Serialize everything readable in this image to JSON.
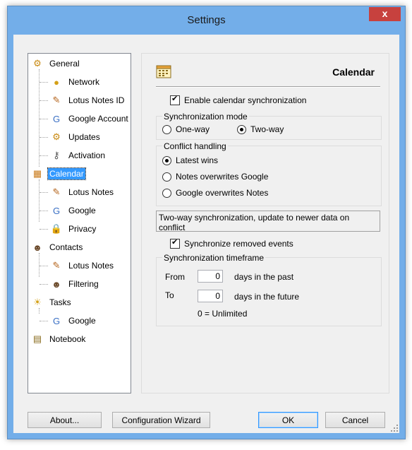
{
  "window": {
    "title": "Settings",
    "close_glyph": "x"
  },
  "tree": [
    {
      "label": "General",
      "icon": "gears-icon",
      "level": 0
    },
    {
      "label": "Network",
      "icon": "network-icon",
      "level": 1
    },
    {
      "label": "Lotus Notes ID",
      "icon": "lotus-notes-id-icon",
      "level": 1
    },
    {
      "label": "Google Account",
      "icon": "google-account-icon",
      "level": 1
    },
    {
      "label": "Updates",
      "icon": "updates-icon",
      "level": 1
    },
    {
      "label": "Activation",
      "icon": "key-icon",
      "level": 1
    },
    {
      "label": "Calendar",
      "icon": "calendar-icon",
      "level": 0,
      "selected": true
    },
    {
      "label": "Lotus Notes",
      "icon": "lotus-notes-icon",
      "level": 1
    },
    {
      "label": "Google",
      "icon": "google-icon",
      "level": 1
    },
    {
      "label": "Privacy",
      "icon": "lock-icon",
      "level": 1
    },
    {
      "label": "Contacts",
      "icon": "contacts-icon",
      "level": 0
    },
    {
      "label": "Lotus Notes",
      "icon": "lotus-notes-icon",
      "level": 1
    },
    {
      "label": "Filtering",
      "icon": "filter-icon",
      "level": 1
    },
    {
      "label": "Tasks",
      "icon": "tasks-icon",
      "level": 0
    },
    {
      "label": "Google",
      "icon": "google-icon",
      "level": 1
    },
    {
      "label": "Notebook",
      "icon": "notebook-icon",
      "level": 0
    }
  ],
  "panel": {
    "title": "Calendar",
    "enable_sync_label": "Enable calendar synchronization",
    "enable_sync_checked": true,
    "sync_mode": {
      "label": "Synchronization mode",
      "options": [
        "One-way",
        "Two-way"
      ],
      "selected": "Two-way"
    },
    "conflict": {
      "label": "Conflict handling",
      "options": [
        "Latest wins",
        "Notes overwrites Google",
        "Google overwrites Notes"
      ],
      "selected": "Latest wins"
    },
    "info_text": "Two-way synchronization, update to newer data on conflict",
    "sync_removed_label": "Synchronize removed events",
    "sync_removed_checked": true,
    "timeframe": {
      "label": "Synchronization timeframe",
      "from_label": "From",
      "from_value": "0",
      "from_suffix": "days in the past",
      "to_label": "To",
      "to_value": "0",
      "to_suffix": "days in the future",
      "note": "0 = Unlimited"
    }
  },
  "buttons": {
    "about": "About...",
    "wizard": "Configuration Wizard",
    "ok": "OK",
    "cancel": "Cancel"
  },
  "colors": {
    "selection": "#3399ff",
    "close": "#c7413e",
    "frame": "#73aee9"
  }
}
